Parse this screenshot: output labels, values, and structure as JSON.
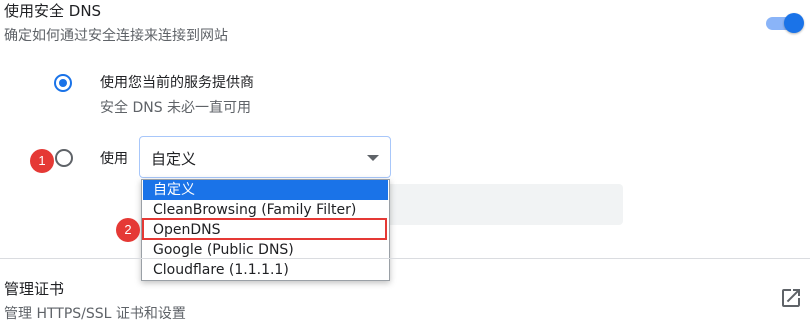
{
  "section": {
    "title": "使用安全 DNS",
    "subtitle": "确定如何通过安全连接来连接到网站",
    "toggle_on": true
  },
  "options": {
    "current_provider": {
      "label": "使用您当前的服务提供商",
      "sublabel": "安全 DNS 未必一直可用",
      "checked": true
    },
    "custom": {
      "label": "使用",
      "checked": false
    }
  },
  "select": {
    "value": "自定义",
    "options": [
      {
        "label": "自定义",
        "selected": true
      },
      {
        "label": "CleanBrowsing (Family Filter)",
        "selected": false
      },
      {
        "label": "OpenDNS",
        "selected": false
      },
      {
        "label": "Google (Public DNS)",
        "selected": false
      },
      {
        "label": "Cloudflare (1.1.1.1)",
        "selected": false
      }
    ]
  },
  "annotations": {
    "badge1": "1",
    "badge2": "2"
  },
  "certificates": {
    "title": "管理证书",
    "subtitle": "管理 HTTPS/SSL 证书和设置",
    "icon": "external-link-icon"
  },
  "colors": {
    "accent": "#1a73e8",
    "annotation": "#e53935"
  }
}
